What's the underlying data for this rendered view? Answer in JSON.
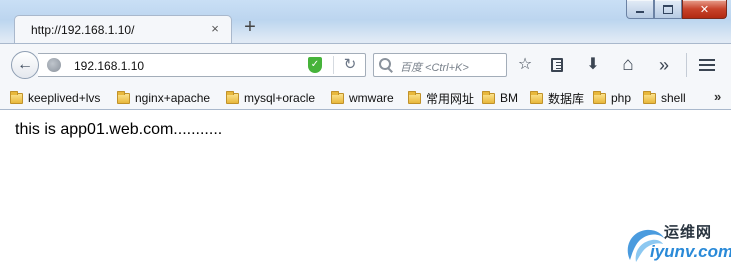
{
  "window": {
    "controls": {
      "minimize_icon": "minimize-icon",
      "maximize_icon": "maximize-icon",
      "close_icon": "close-icon"
    }
  },
  "tabs": [
    {
      "title": "http://192.168.1.10/",
      "close_glyph": "×"
    }
  ],
  "new_tab_glyph": "+",
  "toolbar": {
    "back_glyph": "←",
    "url": "192.168.1.10",
    "shield_glyph": "✓",
    "reload_glyph": "↻",
    "search_placeholder": "百度 <Ctrl+K>",
    "bookmark_star_glyph": "☆",
    "download_glyph": "⬇",
    "home_glyph": "⌂",
    "overflow_glyph": "»"
  },
  "bookmarks": {
    "items": [
      {
        "label": "keeplived+lvs"
      },
      {
        "label": "nginx+apache"
      },
      {
        "label": "mysql+oracle"
      },
      {
        "label": "wmware"
      },
      {
        "label": "常用网址"
      },
      {
        "label": "BM"
      },
      {
        "label": "数据库"
      },
      {
        "label": "php"
      },
      {
        "label": "shell"
      }
    ],
    "more_glyph": "»"
  },
  "page": {
    "text": "this is app01.web.com..........."
  },
  "watermark": {
    "cn": "运维网",
    "en": "iyunv.com"
  },
  "colors": {
    "frame": "#bcd5ef",
    "toolbar": "#f5f7fa",
    "shield": "#46b33a",
    "close_button": "#c8432b",
    "watermark_blue": "#2a8ad8"
  }
}
